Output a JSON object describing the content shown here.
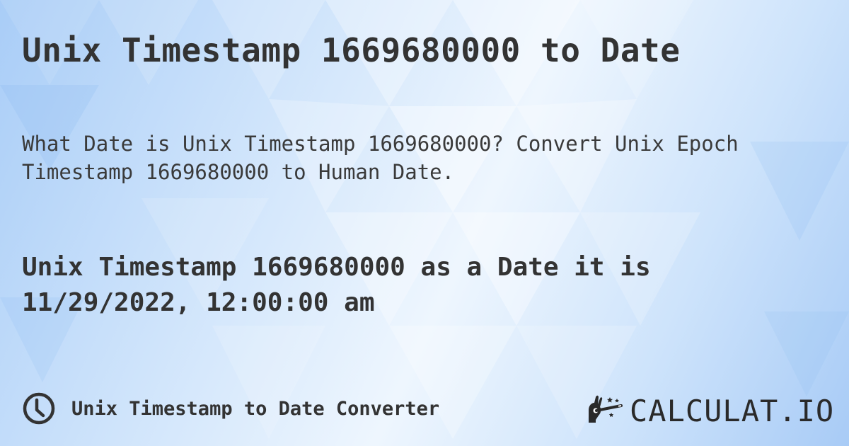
{
  "header": {
    "title": "Unix Timestamp 1669680000 to Date"
  },
  "description": {
    "text": "What Date is Unix Timestamp 1669680000? Convert Unix Epoch Timestamp 1669680000 to Human Date."
  },
  "result": {
    "line1": "Unix Timestamp 1669680000 as a Date it is",
    "line2": "11/29/2022, 12:00:00 am"
  },
  "footer": {
    "converter_icon": "clock-icon",
    "converter_label": "Unix Timestamp to Date Converter",
    "brand_icon": "magic-wand-hand-icon",
    "brand_name": "CALCULAT.IO"
  },
  "colors": {
    "text": "#333333",
    "background_light": "#eef6fe",
    "background_blue": "#a9cdf7"
  }
}
